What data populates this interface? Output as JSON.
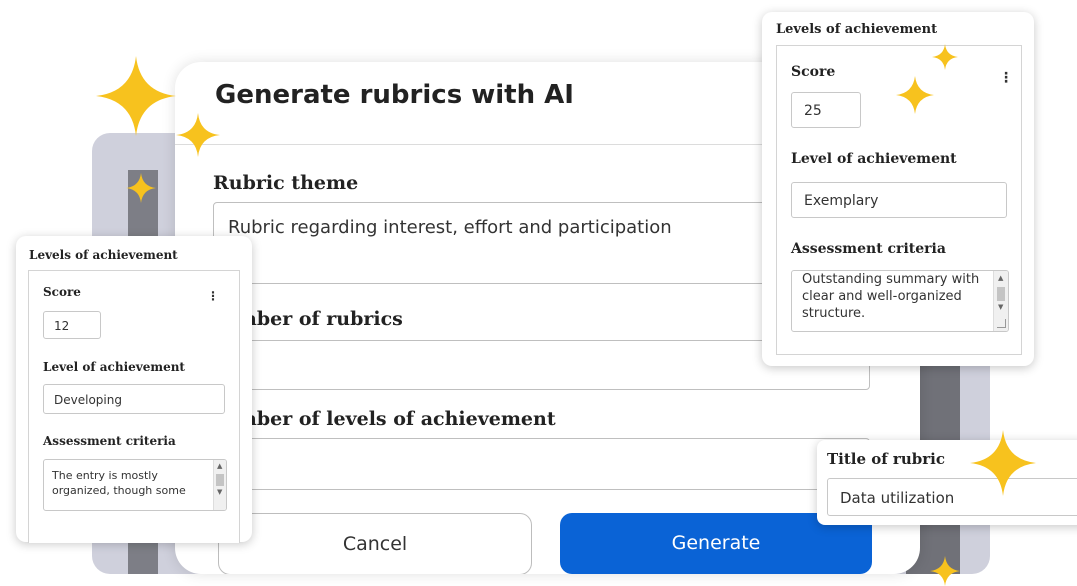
{
  "dialog": {
    "title": "Generate rubrics with AI",
    "theme_label": "Rubric theme",
    "theme_value": "Rubric regarding interest, effort and participation",
    "num_rubrics_label": "nber of rubrics",
    "num_levels_label": "nber of levels of achievement",
    "cancel_label": "Cancel",
    "generate_label": "Generate"
  },
  "card_left": {
    "header": "Levels of achievement",
    "score_label": "Score",
    "score_value": "12",
    "level_label": "Level of achievement",
    "level_value": "Developing",
    "criteria_label": "Assessment criteria",
    "criteria_value": "The entry is mostly organized, though some",
    "menu_icon": "⋮"
  },
  "card_right": {
    "header": "Levels of achievement",
    "score_label": "Score",
    "score_value": "25",
    "level_label": "Level of achievement",
    "level_value": "Exemplary",
    "criteria_label": "Assessment criteria",
    "criteria_value": "Outstanding summary with clear and well-organized structure.",
    "menu_icon": "⋮"
  },
  "card_title": {
    "label": "Title of rubric",
    "value": "Data utilization"
  },
  "colors": {
    "accent": "#0a63d6",
    "sparkle": "#f7c21e",
    "background_panel": "#cfd0dc"
  },
  "icons": {
    "sparkle": "sparkle-icon",
    "menu": "kebab-menu-icon",
    "resize": "resize-grip-icon"
  }
}
